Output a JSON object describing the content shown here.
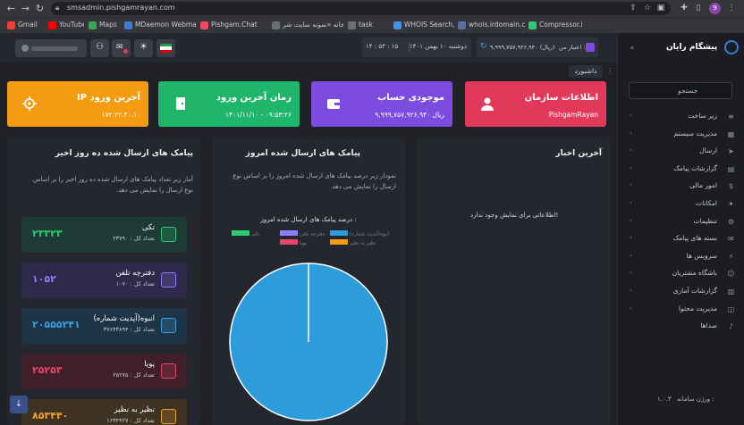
{
  "browser": {
    "url": "smsadmin.pishgamrayan.com",
    "avatar_letter": "9",
    "bookmarks": [
      {
        "label": "Gmail",
        "color": "#ea4335"
      },
      {
        "label": "YouTube",
        "color": "#ff0000"
      },
      {
        "label": "Maps",
        "color": "#34a853"
      },
      {
        "label": "MDaemon Webmai...",
        "color": "#3d7bd9"
      },
      {
        "label": "Pishgam.Chat",
        "color": "#e84a5f"
      },
      {
        "label": "خانه «نمونه سایت شر...",
        "color": "#6b6f78"
      },
      {
        "label": "task",
        "color": "#6b6f78"
      },
      {
        "label": "WHOIS Search, Do...",
        "color": "#4a90e2"
      },
      {
        "label": "whois.irdomain.com",
        "color": "#5b6f9e"
      },
      {
        "label": "Compressor.io",
        "color": "#2ecc71"
      }
    ]
  },
  "topbar": {
    "datetime": "دوشنبه ۱۰ بهمن ۱۴۰۱",
    "clock": "۱۴ : ۵۳ : ۱۵",
    "credit_label": "اعتبار من :",
    "credit_value": "۹,۹۹۹,۷۵۷,۹۲۶,۹۴۰ (ریال)"
  },
  "sidebar": {
    "brand": "پیشگام رایان",
    "search_label": "جستجو",
    "items": [
      {
        "label": "زیر ساخت",
        "icon": "layers-icon",
        "glyph": "≡",
        "chevron": true
      },
      {
        "label": "مدیریت سیستم",
        "icon": "system-icon",
        "glyph": "▦",
        "chevron": true
      },
      {
        "label": "ارسال",
        "icon": "send-icon",
        "glyph": "➤",
        "chevron": true
      },
      {
        "label": "گزارشات پیامک",
        "icon": "report-icon",
        "glyph": "▤",
        "chevron": true
      },
      {
        "label": "امور مالی",
        "icon": "finance-icon",
        "glyph": "$",
        "chevron": true
      },
      {
        "label": "امکانات",
        "icon": "features-icon",
        "glyph": "✦",
        "chevron": true
      },
      {
        "label": "تنظیمات",
        "icon": "settings-icon",
        "glyph": "⚙",
        "chevron": true
      },
      {
        "label": "بسته های پیامک",
        "icon": "package-icon",
        "glyph": "✉",
        "chevron": true
      },
      {
        "label": "سرویس ها",
        "icon": "service-icon",
        "glyph": "⚡",
        "chevron": true
      },
      {
        "label": "باشگاه مشتریان",
        "icon": "club-icon",
        "glyph": "☺",
        "chevron": true
      },
      {
        "label": "گزارشات آماری",
        "icon": "stats-icon",
        "glyph": "▥",
        "chevron": true
      },
      {
        "label": "مدیریت محتوا",
        "icon": "content-icon",
        "glyph": "◫",
        "chevron": true
      },
      {
        "label": "صداها",
        "icon": "sound-icon",
        "glyph": "♪",
        "chevron": false
      }
    ],
    "version_label": "ورژن سامانه :",
    "version_value": "۱.۰.۳"
  },
  "breadcrumb": "داشبورد",
  "cards": [
    {
      "title": "اطلاعات سازمان",
      "value": "PishgamRayan",
      "color": "#e2395b",
      "icon": "user-icon"
    },
    {
      "title": "موجودی حساب",
      "value": "۹,۹۹۹,۷۵۷,۹۲۶,۹۴۰ ریال",
      "color": "#7c4ce0",
      "icon": "wallet-icon"
    },
    {
      "title": "زمان آخرین ورود",
      "value": "۱۴۰۱/۱۱/۱۰ - ۰۹:۵۳:۲۶",
      "color": "#1fb56b",
      "icon": "door-icon"
    },
    {
      "title": "IP آخرین ورود",
      "value": "۱۷۲.۲۲.۴۰.۱۰",
      "color": "#f39c12",
      "icon": "target-icon"
    }
  ],
  "news": {
    "title": "آخرین اخبار",
    "empty": "اطلاعاتی برای نمایش وجود ندارد!"
  },
  "today": {
    "title": "پیامک های ارسال شده امروز",
    "desc": "نمودار زیر درصد پیامک های ارسال شده امروز را بر اساس نوع ارسال را نمایش می دهد."
  },
  "tendays": {
    "title": "پیامک های ارسال شده ده روز اخیر",
    "desc": "آمار زیر تعداد پیامک های ارسال شده ده روز اخیر را بر اساس نوع ارسال را نمایش می دهد."
  },
  "sms_types": [
    {
      "name": "تکی",
      "total": "تعداد کل : ۲۳۷۹۰",
      "value": "۲۳۳۲۳",
      "bg": "#1f3b36",
      "accent": "#2ecc71"
    },
    {
      "name": "دفترچه تلفن",
      "total": "تعداد کل : ۱۰۷۰",
      "value": "۱۰۵۲",
      "bg": "#2d2a4a",
      "accent": "#8e7cff"
    },
    {
      "name": "انبوه(آپدیت شماره)",
      "total": "تعداد کل : ۳۷۶۴۳۸۹۴",
      "value": "۲۰۵۵۵۲۴۱",
      "bg": "#1e3548",
      "accent": "#3aa0e0"
    },
    {
      "name": "پویا",
      "total": "تعداد کل : ۲۵۲۷۵",
      "value": "۲۵۲۵۳",
      "bg": "#3e1f2a",
      "accent": "#e8466a"
    },
    {
      "name": "نظیر به نظیر",
      "total": "تعداد کل : ۱۶۳۴۴۲۷",
      "value": "۸۵۳۴۴۰",
      "bg": "#3e3322",
      "accent": "#f0a030"
    }
  ],
  "chart_data": {
    "type": "pie",
    "title": "درصد پیامک های ارسال شده امروز :",
    "series": [
      {
        "name": "تکی",
        "value": 0,
        "color": "#2ecc71"
      },
      {
        "name": "دفترچه تلفن",
        "value": 0,
        "color": "#8e7cff"
      },
      {
        "name": "انبوه(آپدیت شماره)",
        "value": 100,
        "color": "#2d9cdb"
      },
      {
        "name": "پویا",
        "value": 0,
        "color": "#e8466a"
      },
      {
        "name": "نظیر به نظیر",
        "value": 0,
        "color": "#f39c12"
      }
    ]
  }
}
